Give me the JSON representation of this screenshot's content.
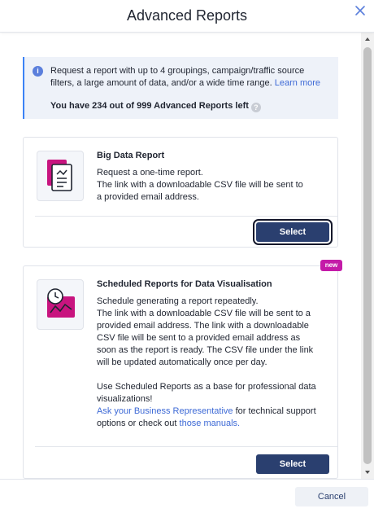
{
  "modal": {
    "title": "Advanced Reports"
  },
  "info": {
    "text": "Request a report with up to 4 groupings, campaign/traffic source filters, a large amount of data, and/or a wide time range.",
    "learn_more": "Learn more",
    "quota": "You have 234 out of 999 Advanced Reports left"
  },
  "cards": [
    {
      "title": "Big Data Report",
      "description": "Request a one-time report.\nThe link with a downloadable CSV file will be sent to a provided email address.",
      "select_label": "Select"
    },
    {
      "title": "Scheduled Reports for Data Visualisation",
      "badge": "new",
      "description": "Schedule generating a report repeatedly.\nThe link with a downloadable CSV file will be sent to a provided email address. The link with a downloadable CSV file will be sent to a provided email address as soon as the report is ready. The CSV file under the link will be updated automatically once per day.",
      "extra_text": "Use Scheduled Reports as a base for professional data visualizations!",
      "rep_link": "Ask your Business Representative",
      "support_text": "for technical support options or check out",
      "manuals_link": "those manuals.",
      "select_label": "Select"
    }
  ],
  "footer": {
    "cancel_label": "Cancel"
  },
  "colors": {
    "primary": "#2a3f6f",
    "accent_link": "#3e6ad6",
    "badge": "#c41ba8",
    "icon_magenta": "#c8147f",
    "info_bg": "#eef2f9"
  },
  "icons": {
    "close": "close-icon",
    "info": "info-icon",
    "help": "help-icon",
    "report": "report-document-icon",
    "scheduled": "clock-chart-icon"
  }
}
